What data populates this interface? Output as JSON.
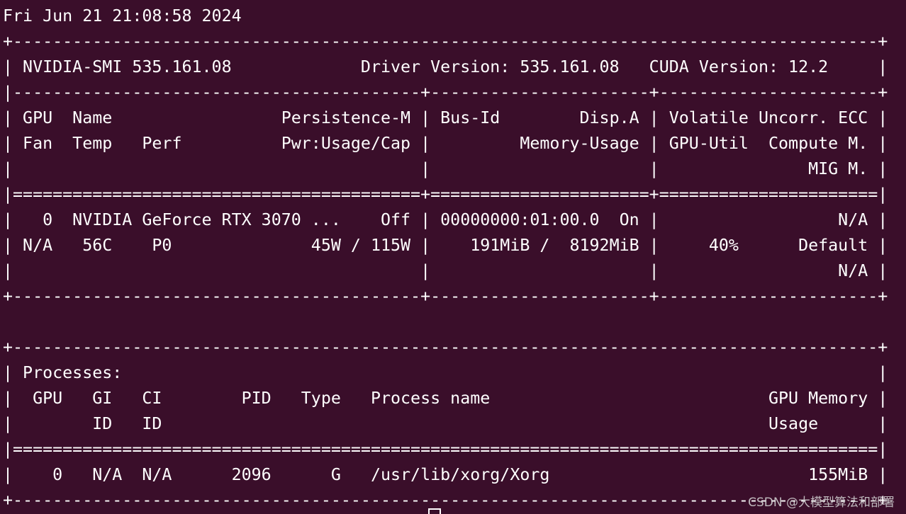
{
  "terminal": {
    "background": "#3a0e2a",
    "foreground": "#ffffff",
    "lines": [
      "Fri Jun 21 21:08:58 2024",
      "+---------------------------------------------------------------------------------------+",
      "| NVIDIA-SMI 535.161.08             Driver Version: 535.161.08   CUDA Version: 12.2     |",
      "|-----------------------------------------+----------------------+----------------------+",
      "| GPU  Name                 Persistence-M | Bus-Id        Disp.A | Volatile Uncorr. ECC |",
      "| Fan  Temp   Perf          Pwr:Usage/Cap |         Memory-Usage | GPU-Util  Compute M. |",
      "|                                         |                      |               MIG M. |",
      "|=========================================+======================+======================|",
      "|   0  NVIDIA GeForce RTX 3070 ...    Off | 00000000:01:00.0  On |                  N/A |",
      "| N/A   56C    P0              45W / 115W |    191MiB /  8192MiB |     40%      Default |",
      "|                                         |                      |                  N/A |",
      "+-----------------------------------------+----------------------+----------------------+",
      "",
      "+---------------------------------------------------------------------------------------+",
      "| Processes:                                                                            |",
      "|  GPU   GI   CI        PID   Type   Process name                            GPU Memory |",
      "|        ID   ID                                                             Usage      |",
      "|=======================================================================================|",
      "|    0   N/A  N/A      2096      G   /usr/lib/xorg/Xorg                          155MiB |",
      "+---------------------------------------------------------------------------------------+"
    ]
  },
  "watermark": "CSDN @大模型算法和部署"
}
